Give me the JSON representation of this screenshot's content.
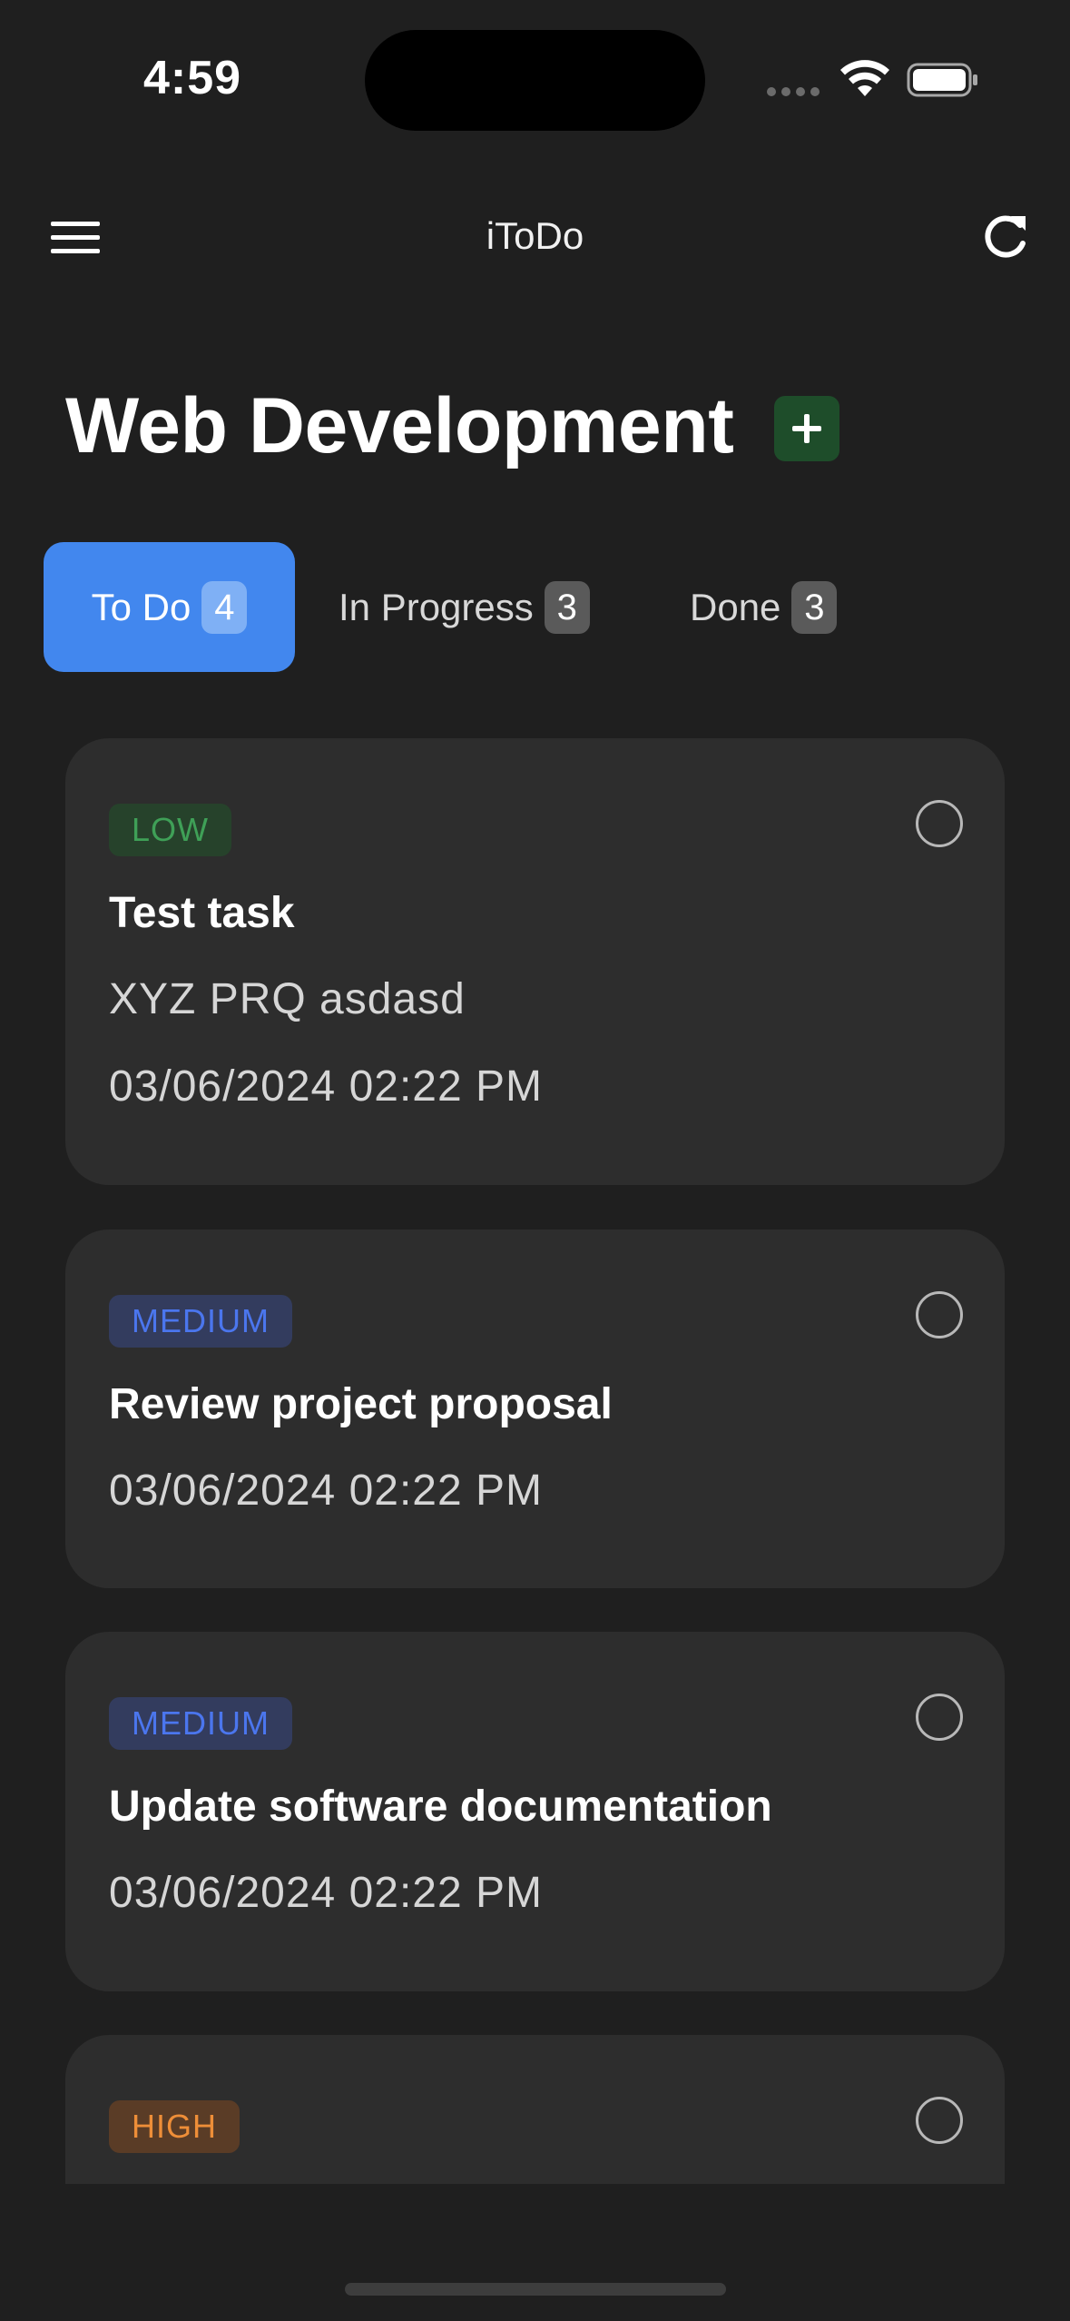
{
  "status_bar": {
    "time": "4:59"
  },
  "nav": {
    "title": "iToDo",
    "menu_icon": "hamburger-menu-icon",
    "refresh_icon": "refresh-icon"
  },
  "page": {
    "title": "Web Development",
    "add_icon": "plus-icon"
  },
  "tabs": [
    {
      "label": "To Do",
      "count": "4",
      "active": true
    },
    {
      "label": "In Progress",
      "count": "3",
      "active": false
    },
    {
      "label": "Done",
      "count": "3",
      "active": false
    }
  ],
  "tasks": [
    {
      "priority": "LOW",
      "title": "Test task",
      "description": "XYZ PRQ asdasd",
      "date": "03/06/2024 02:22 PM"
    },
    {
      "priority": "MEDIUM",
      "title": "Review project proposal",
      "date": "03/06/2024 02:22 PM"
    },
    {
      "priority": "MEDIUM",
      "title": "Update software documentation",
      "date": "03/06/2024 02:22 PM"
    },
    {
      "priority": "HIGH"
    }
  ],
  "colors": {
    "background": "#1f1f1f",
    "card": "#2d2d2d",
    "accent": "#4287ee",
    "low": "#3fa057",
    "medium": "#4b76ee",
    "high": "#ee8e38",
    "add_button": "#1e4d2a"
  }
}
